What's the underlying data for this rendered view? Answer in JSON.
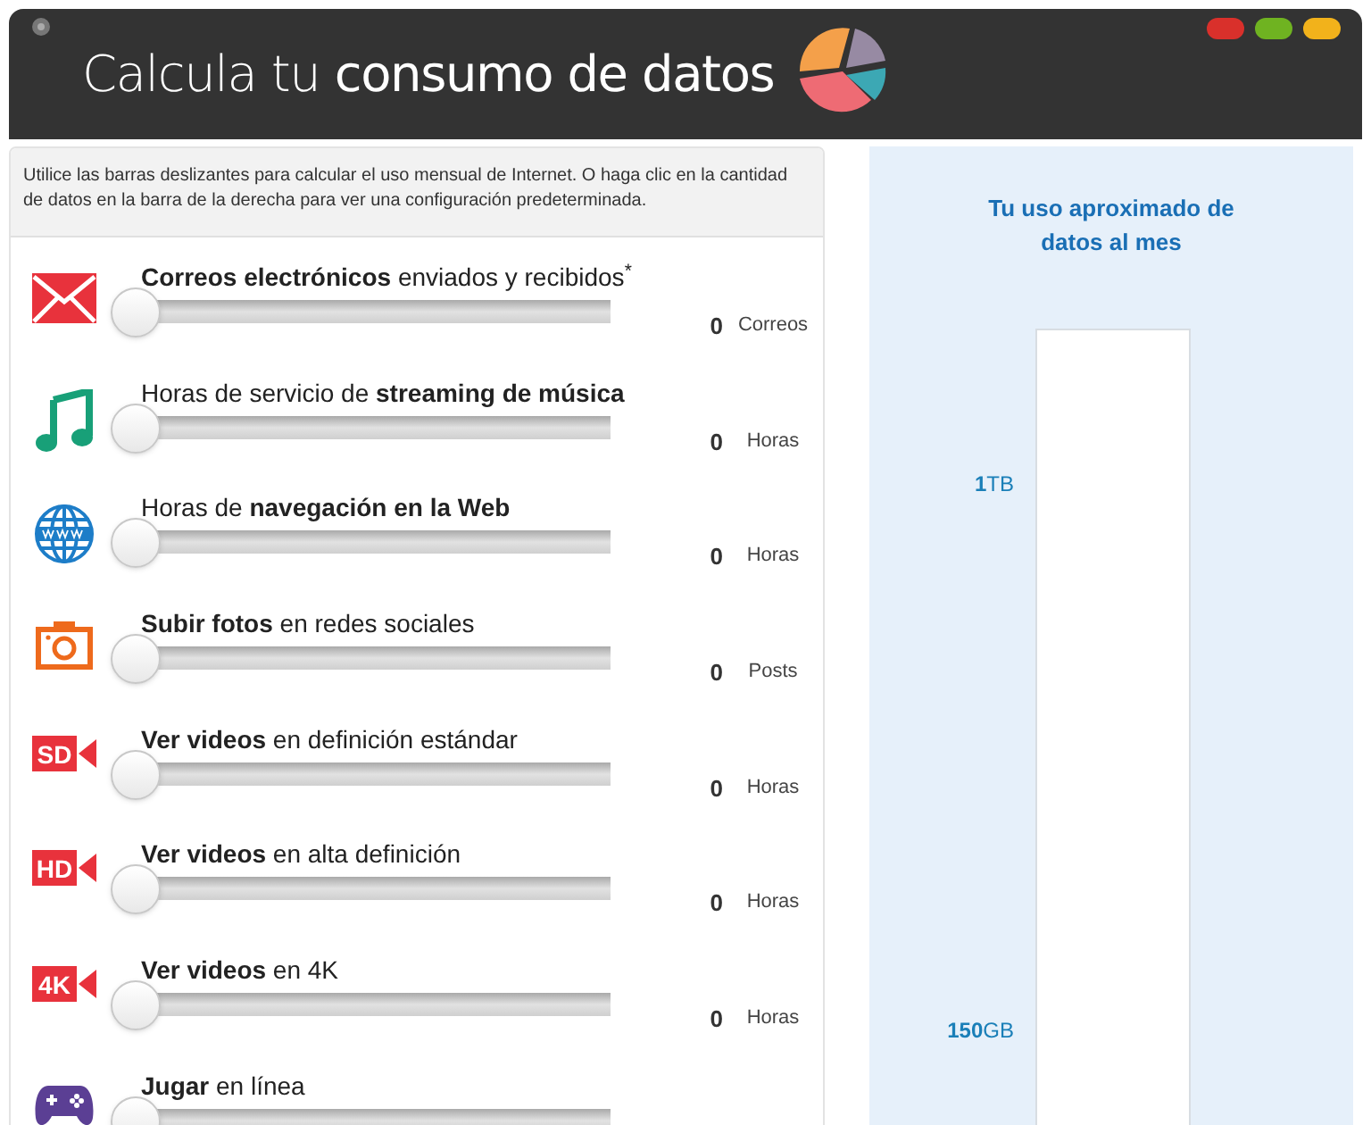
{
  "header": {
    "title": "Calcula tu **consumo de datos**"
  },
  "intro": "Utilice las barras deslizantes para calcular el uso mensual de Internet. O haga clic en la cantidad de datos en la barra de la derecha para ver una configuración predeterminada.",
  "activities": [
    {
      "label": "**Correos electrónicos** enviados y recibidos$^{*}$",
      "level": 0,
      "value": "0",
      "unit": "Correos"
    },
    {
      "label": "Horas de servicio de **streaming de música**",
      "level": 0,
      "value": "0",
      "unit": "Horas"
    },
    {
      "label": "Horas de **navegación en la Web**",
      "level": 0,
      "value": "0",
      "unit": "Horas"
    },
    {
      "label": "**Subir fotos** en redes sociales",
      "level": 0,
      "value": "0",
      "unit": "Posts"
    },
    {
      "label": "**Ver videos** en definición estándar",
      "icon_label": "SD",
      "level": 0,
      "value": "0",
      "unit": "Horas"
    },
    {
      "label": "**Ver videos** en alta definición",
      "icon_label": "HD",
      "level": 0,
      "value": "0",
      "unit": "Horas"
    },
    {
      "label": "**Ver videos** en 4K",
      "icon_label": "4K",
      "level": 0,
      "value": "0",
      "unit": "Horas"
    },
    {
      "label": "**Jugar** en línea",
      "level": 0
    }
  ],
  "usage_panel": {
    "title": "Tu uso aproximado de datos al mes",
    "scale_labels": [
      "**1**TB",
      "**150**GB"
    ]
  }
}
